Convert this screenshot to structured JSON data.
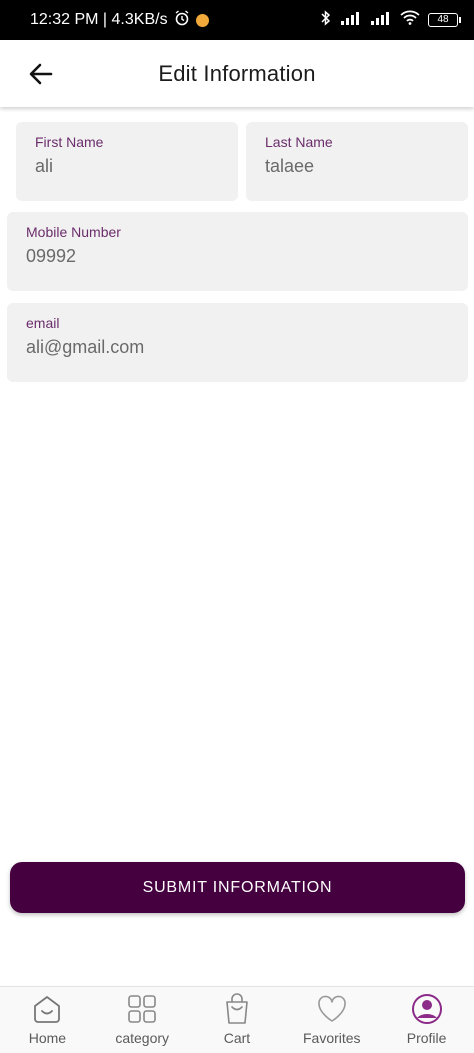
{
  "status_bar": {
    "time_speed": "12:32 PM | 4.3KB/s",
    "battery": "48"
  },
  "header": {
    "title": "Edit Information"
  },
  "form": {
    "first_name": {
      "label": "First Name",
      "value": "ali"
    },
    "last_name": {
      "label": "Last Name",
      "value": "talaee"
    },
    "mobile": {
      "label": "Mobile Number",
      "value": "09992"
    },
    "email": {
      "label": "email",
      "value": "ali@gmail.com"
    }
  },
  "submit_label": "SUBMIT INFORMATION",
  "nav": {
    "items": [
      {
        "label": "Home",
        "icon": "home-icon"
      },
      {
        "label": "category",
        "icon": "grid-icon"
      },
      {
        "label": "Cart",
        "icon": "bag-icon"
      },
      {
        "label": "Favorites",
        "icon": "heart-icon"
      },
      {
        "label": "Profile",
        "icon": "profile-icon"
      }
    ]
  },
  "colors": {
    "accent": "#44003f",
    "label": "#6b2d6b",
    "field_bg": "#f1f1f1",
    "profile_active": "#8b2a88"
  }
}
